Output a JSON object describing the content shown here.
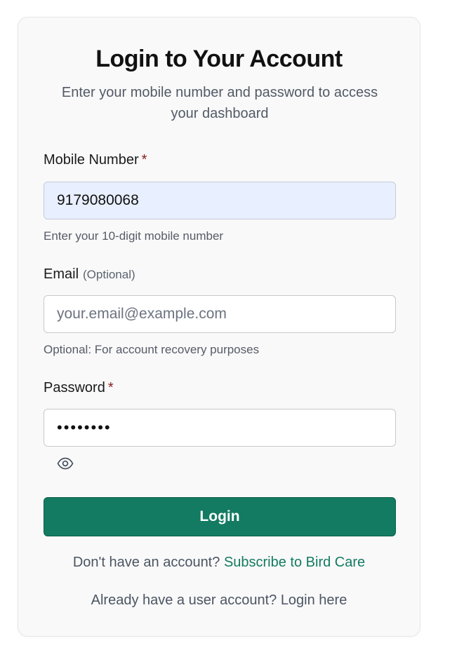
{
  "header": {
    "title": "Login to Your Account",
    "subtitle": "Enter your mobile number and password to access your dashboard"
  },
  "mobile": {
    "label": "Mobile Number",
    "required_mark": "*",
    "value": "9179080068",
    "hint": "Enter your 10-digit mobile number"
  },
  "email": {
    "label": "Email",
    "optional_tag": "(Optional)",
    "value": "",
    "placeholder": "your.email@example.com",
    "hint": "Optional: For account recovery purposes"
  },
  "password": {
    "label": "Password",
    "required_mark": "*",
    "value": "••••••••",
    "toggle_icon": "eye-icon"
  },
  "actions": {
    "login_label": "Login"
  },
  "footer": {
    "signup_prompt": "Don't have an account?",
    "signup_link": "Subscribe to Bird Care",
    "user_login_prompt": "Already have a user account?",
    "user_login_link": "Login here"
  },
  "colors": {
    "primary": "#137b61",
    "required": "#8b1a1a",
    "filled_input_bg": "#e8efff"
  }
}
